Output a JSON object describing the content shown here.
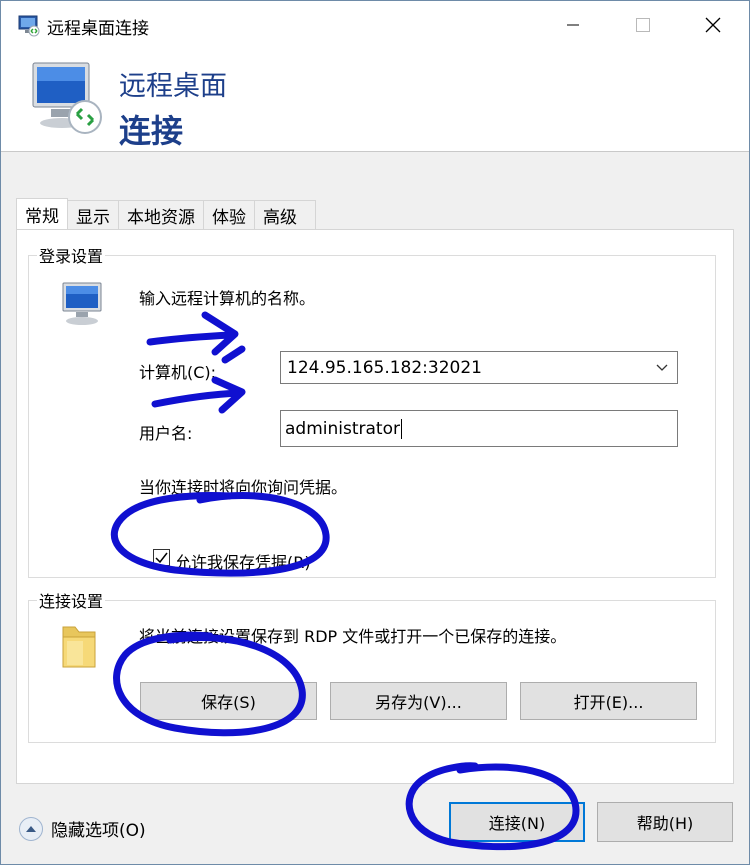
{
  "window": {
    "title": "远程桌面连接"
  },
  "banner": {
    "line1": "远程桌面",
    "line2": "连接"
  },
  "tabs": [
    {
      "label": "常规"
    },
    {
      "label": "显示"
    },
    {
      "label": "本地资源"
    },
    {
      "label": "体验"
    },
    {
      "label": "高级"
    }
  ],
  "login": {
    "legend": "登录设置",
    "prompt": "输入远程计算机的名称。",
    "computer_label": "计算机(C):",
    "computer_value": "124.95.165.182:32021",
    "username_label": "用户名:",
    "username_value": "administrator",
    "hint": "当你连接时将向你询问凭据。",
    "save_credentials_label": "允许我保存凭据(R)",
    "save_credentials_checked": true
  },
  "connection": {
    "legend": "连接设置",
    "description": "将当前连接设置保存到 RDP 文件或打开一个已保存的连接。",
    "save_label": "保存(S)",
    "save_as_label": "另存为(V)...",
    "open_label": "打开(E)..."
  },
  "footer": {
    "options_label": "隐藏选项(O)",
    "connect_label": "连接(N)",
    "help_label": "帮助(H)"
  },
  "colors": {
    "banner_title": "#1d3f8a",
    "annotation_ink": "#1010d0",
    "accent": "#0078d7"
  }
}
